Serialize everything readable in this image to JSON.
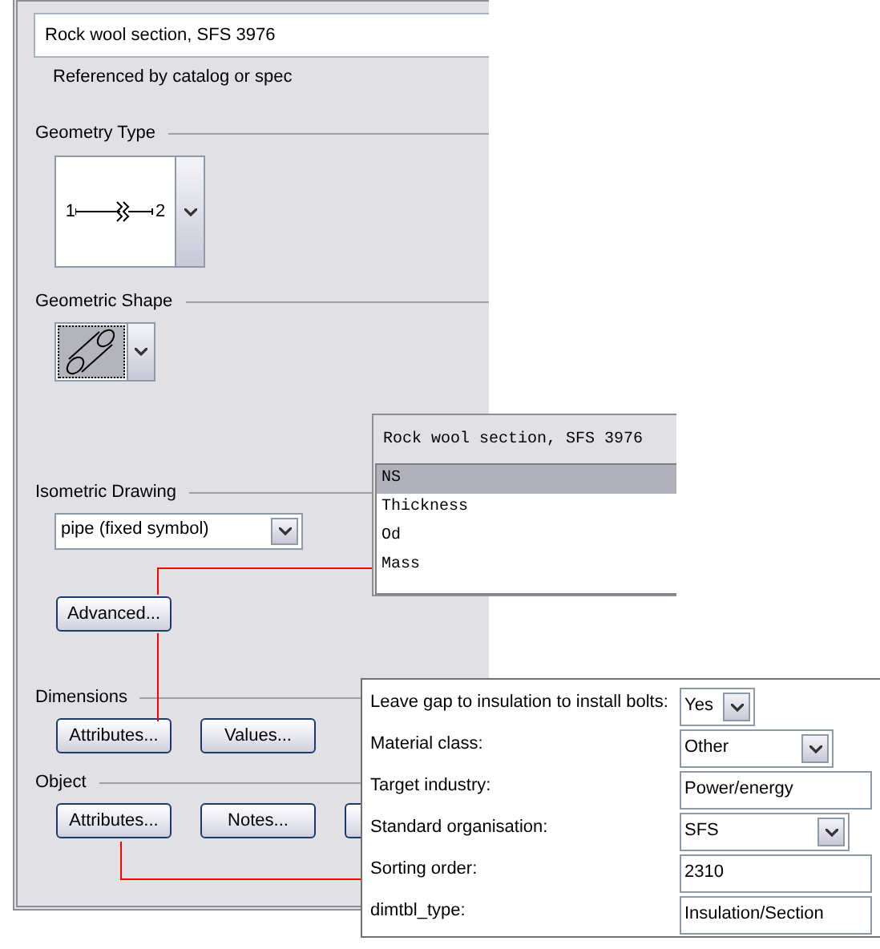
{
  "name_field": {
    "value": "Rock wool section, SFS 3976"
  },
  "reference_note": "Referenced by catalog or spec",
  "geometry_type": {
    "label": "Geometry Type",
    "endpoints": [
      "1",
      "2"
    ]
  },
  "geometric_shape": {
    "label": "Geometric Shape"
  },
  "isometric_drawing": {
    "label": "Isometric Drawing",
    "value": "pipe (fixed symbol)",
    "button": "Advanced..."
  },
  "dimensions": {
    "label": "Dimensions",
    "buttons": [
      "Attributes...",
      "Values..."
    ]
  },
  "object": {
    "label": "Object",
    "buttons": [
      "Attributes...",
      "Notes..."
    ]
  },
  "dimension_list": {
    "title": "Rock wool section, SFS 3976",
    "items": [
      {
        "label": "NS",
        "selected": true
      },
      {
        "label": "Thickness",
        "selected": false
      },
      {
        "label": "Od",
        "selected": false
      },
      {
        "label": "Mass",
        "selected": false
      }
    ]
  },
  "attributes": [
    {
      "label": "Leave gap to insulation to install bolts:",
      "kind": "dropdown",
      "value": "Yes"
    },
    {
      "label": "Material class:",
      "kind": "dropdown",
      "value": "Other"
    },
    {
      "label": "Target industry:",
      "kind": "text",
      "value": "Power/energy"
    },
    {
      "label": "Standard organisation:",
      "kind": "dropdown",
      "value": "SFS"
    },
    {
      "label": "Sorting order:",
      "kind": "text",
      "value": "2310"
    },
    {
      "label": "dimtbl_type:",
      "kind": "text",
      "value": "Insulation/Section"
    }
  ]
}
